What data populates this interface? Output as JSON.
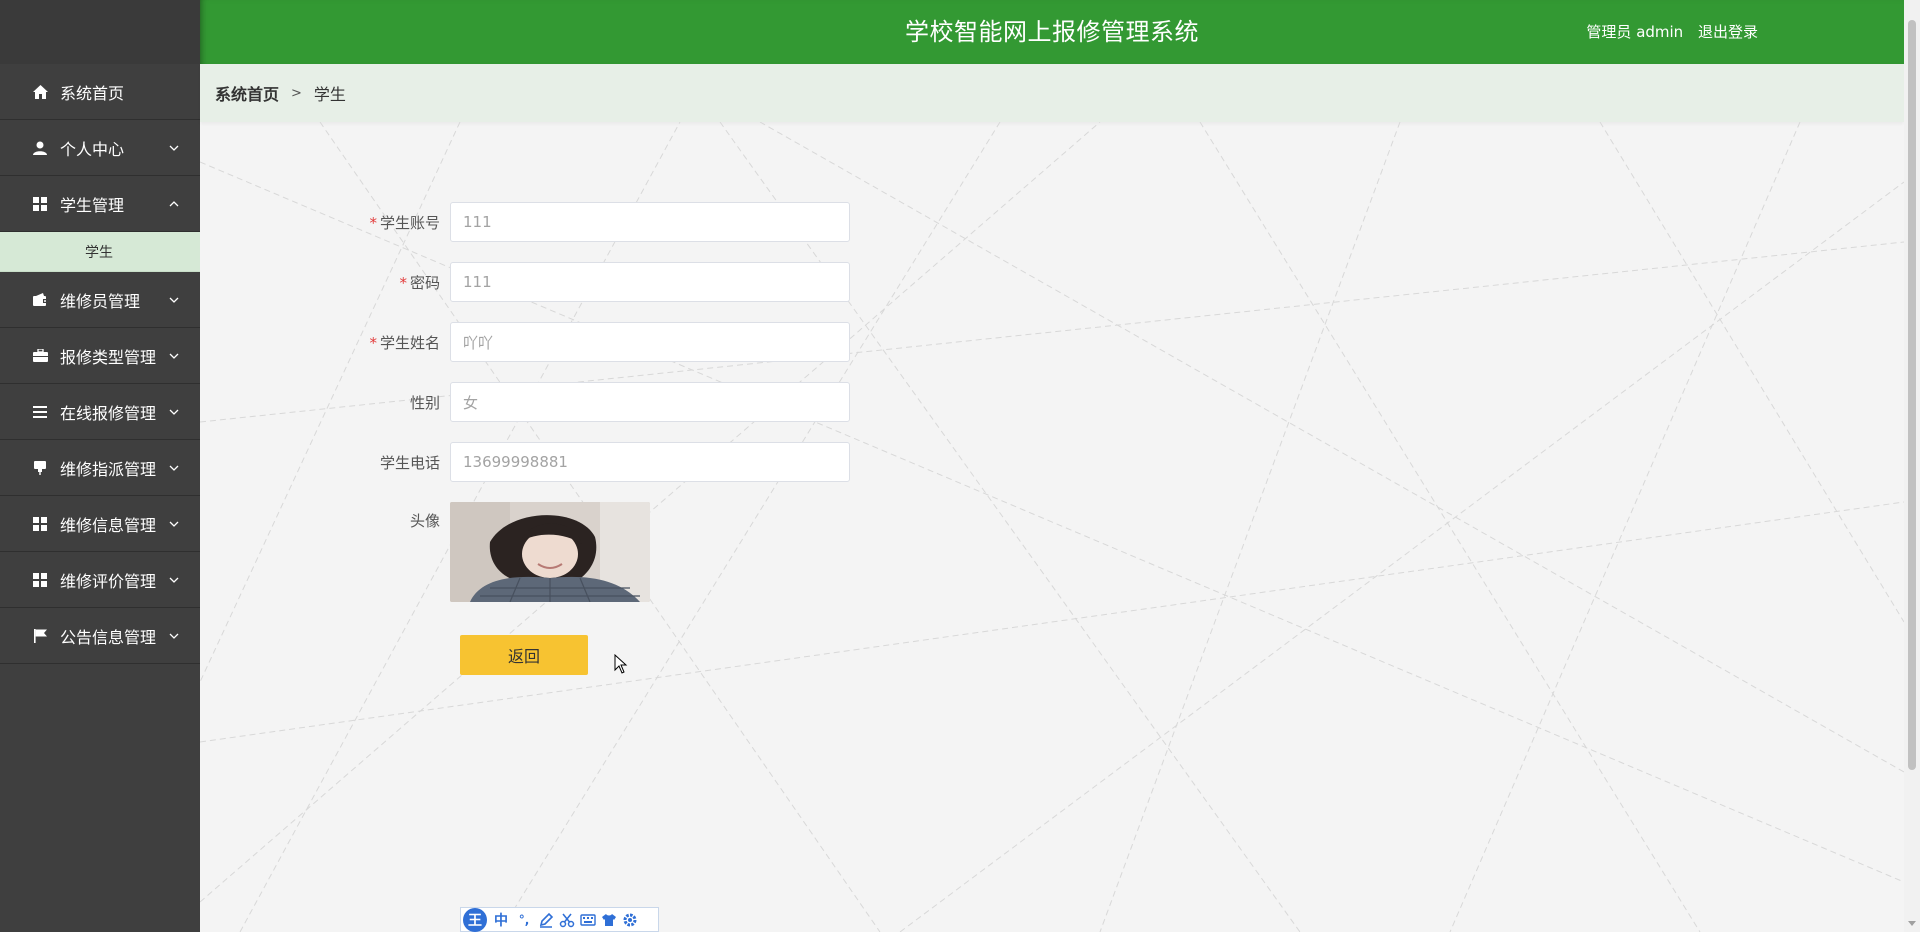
{
  "header": {
    "title": "学校智能网上报修管理系统",
    "user_label": "管理员 admin",
    "logout_label": "退出登录"
  },
  "breadcrumb": {
    "home": "系统首页",
    "separator": ">",
    "current": "学生"
  },
  "sidebar": {
    "items": [
      {
        "label": "系统首页",
        "icon": "home-icon"
      },
      {
        "label": "个人中心",
        "icon": "user-icon",
        "expandable": true
      },
      {
        "label": "学生管理",
        "icon": "grid-icon",
        "expanded": true
      },
      {
        "label": "维修员管理",
        "icon": "wallet-icon",
        "expandable": true
      },
      {
        "label": "报修类型管理",
        "icon": "briefcase-icon",
        "expandable": true
      },
      {
        "label": "在线报修管理",
        "icon": "list-icon",
        "expandable": true
      },
      {
        "label": "维修指派管理",
        "icon": "pin-icon",
        "expandable": true
      },
      {
        "label": "维修信息管理",
        "icon": "grid-icon",
        "expandable": true
      },
      {
        "label": "维修评价管理",
        "icon": "grid-icon",
        "expandable": true
      },
      {
        "label": "公告信息管理",
        "icon": "flag-icon",
        "expandable": true
      }
    ],
    "sub_item": "学生"
  },
  "form": {
    "account": {
      "label": "学生账号",
      "value": "111",
      "required": true
    },
    "password": {
      "label": "密码",
      "value": "111",
      "required": true
    },
    "name": {
      "label": "学生姓名",
      "value": "吖吖",
      "required": true
    },
    "gender": {
      "label": "性别",
      "value": "女",
      "required": false
    },
    "phone": {
      "label": "学生电话",
      "value": "13699998881",
      "required": false
    },
    "avatar": {
      "label": "头像"
    },
    "required_mark": "*",
    "back_label": "返回"
  },
  "ime": {
    "logo": "王",
    "mode": "中",
    "punct": "°,"
  },
  "colors": {
    "header": "#339933",
    "sidebar": "#3f3f3f",
    "submenu_active": "#d6e9d6",
    "back_button": "#f7c331"
  }
}
